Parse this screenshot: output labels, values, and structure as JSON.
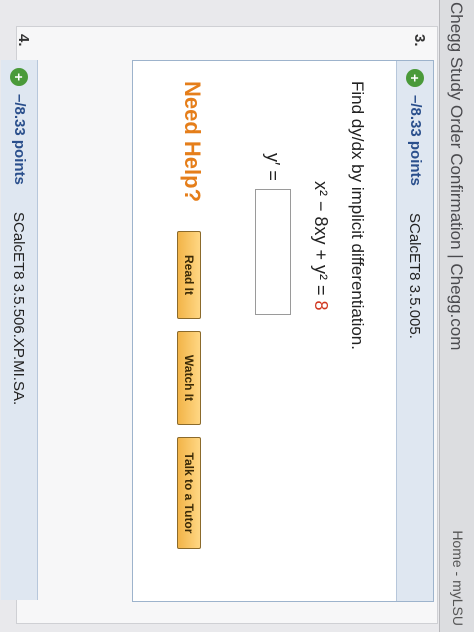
{
  "window": {
    "title": "Chegg Study Order Confirmation | Chegg.com",
    "home_link": "Home - myLSU"
  },
  "question3": {
    "number": "3.",
    "points": "–/8.33 points",
    "code": "SCalcET8 3.5.005.",
    "prompt": "Find dy/dx by implicit differentiation.",
    "equation": {
      "lhs": "x² − 8xy + y² = ",
      "rhs": "8"
    },
    "answer_label": "y′ =",
    "answer_value": "",
    "need_help": "Need Help?",
    "buttons": {
      "read": "Read It",
      "watch": "Watch It",
      "tutor": "Talk to a Tutor"
    }
  },
  "question4": {
    "number": "4.",
    "points": "–/8.33 points",
    "code": "SCalcET8 3.5.506.XP.MI.SA."
  },
  "icons": {
    "expand": "plus-circle-icon"
  },
  "colors": {
    "points": "#2a4f8c",
    "need_help": "#e57e1a",
    "equation_highlight": "#d0361f"
  }
}
